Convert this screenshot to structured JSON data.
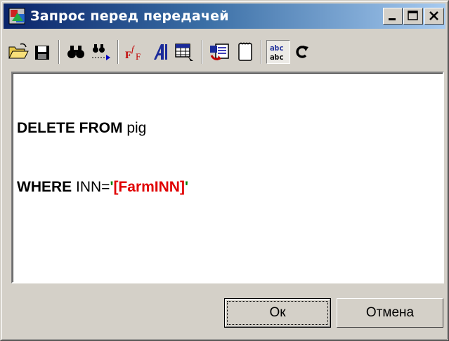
{
  "window": {
    "title": "Запрос перед передачей"
  },
  "caption_buttons": {
    "minimize": "_",
    "maximize": "□",
    "close": "×"
  },
  "toolbar": {
    "items": [
      {
        "name": "open-icon"
      },
      {
        "name": "save-icon"
      },
      {
        "name": "find-icon"
      },
      {
        "name": "find-next-icon"
      },
      {
        "name": "font-icon"
      },
      {
        "name": "font-style-icon"
      },
      {
        "name": "table-icon"
      },
      {
        "name": "run-query-icon"
      },
      {
        "name": "blank-document-icon"
      },
      {
        "name": "spell-check-icon",
        "pressed": true
      },
      {
        "name": "redo-icon"
      }
    ],
    "font_icon_text": "FfF",
    "spell_icon_top": "abc",
    "spell_icon_bottom": "abc"
  },
  "editor": {
    "line1": {
      "keyword": "DELETE FROM",
      "rest": " pig"
    },
    "line2": {
      "keyword": "WHERE",
      "field": " INN=",
      "quote_open": "'",
      "param": "[FarmINN]",
      "quote_close": "'"
    }
  },
  "buttons": {
    "ok_label": "Ок",
    "cancel_label": "Отмена"
  },
  "colors": {
    "title_gradient_start": "#0a246a",
    "title_gradient_end": "#a6caf0",
    "sql_keyword": "#000000",
    "sql_string_quote": "#008000",
    "sql_parameter": "#e00000",
    "window_face": "#d4d0c8"
  }
}
